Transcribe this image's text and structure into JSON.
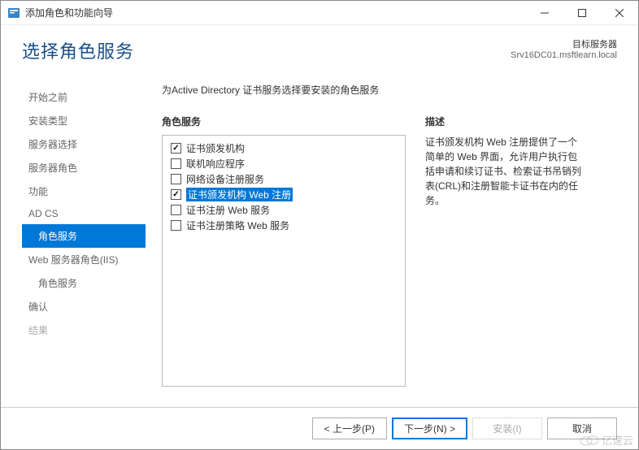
{
  "titlebar": {
    "text": "添加角色和功能向导"
  },
  "header": {
    "title": "选择角色服务",
    "target_label": "目标服务器",
    "target_value": "Srv16DC01.msftlearn.local"
  },
  "sidebar": {
    "items": [
      {
        "label": "开始之前"
      },
      {
        "label": "安装类型"
      },
      {
        "label": "服务器选择"
      },
      {
        "label": "服务器角色"
      },
      {
        "label": "功能"
      },
      {
        "label": "AD CS"
      },
      {
        "label": "角色服务"
      },
      {
        "label": "Web 服务器角色(IIS)"
      },
      {
        "label": "角色服务"
      },
      {
        "label": "确认"
      },
      {
        "label": "结果"
      }
    ]
  },
  "main": {
    "instruction": "为Active Directory 证书服务选择要安装的角色服务",
    "roles_heading": "角色服务",
    "desc_heading": "描述",
    "options": [
      {
        "label": "证书颁发机构",
        "checked": true,
        "selected": false
      },
      {
        "label": "联机响应程序",
        "checked": false,
        "selected": false
      },
      {
        "label": "网络设备注册服务",
        "checked": false,
        "selected": false
      },
      {
        "label": "证书颁发机构 Web 注册",
        "checked": true,
        "selected": true
      },
      {
        "label": "证书注册 Web 服务",
        "checked": false,
        "selected": false
      },
      {
        "label": "证书注册策略 Web 服务",
        "checked": false,
        "selected": false
      }
    ],
    "description": "证书颁发机构 Web 注册提供了一个简单的 Web 界面，允许用户执行包括申请和续订证书、检索证书吊销列表(CRL)和注册智能卡证书在内的任务。"
  },
  "footer": {
    "prev": "< 上一步(P)",
    "next": "下一步(N) >",
    "install": "安装(I)",
    "cancel": "取消"
  },
  "watermark": "亿速云"
}
